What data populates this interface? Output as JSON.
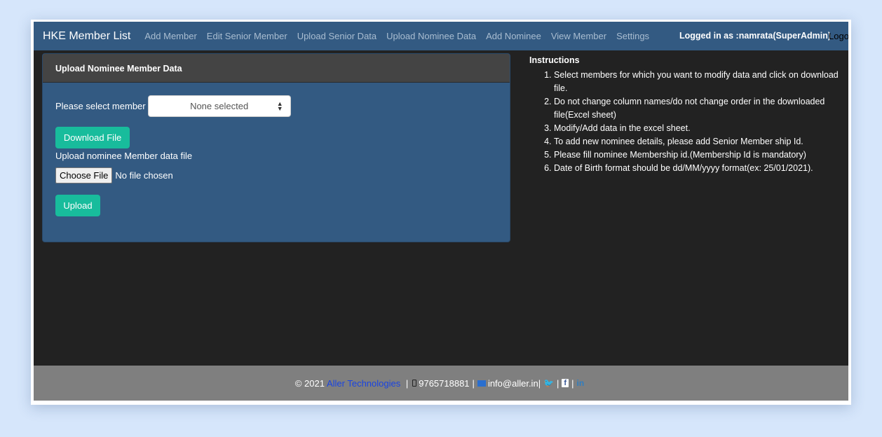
{
  "nav": {
    "brand": "HKE Member List",
    "links": [
      "Add Member",
      "Edit Senior Member",
      "Upload Senior Data",
      "Upload Nominee Data",
      "Add Nominee",
      "View Member",
      "Settings"
    ],
    "logged_in": "Logged in as :namrata(SuperAdmin)",
    "logout": "Logo"
  },
  "panel": {
    "title": "Upload Nominee Member Data",
    "select_label": "Please select member",
    "select_value": "None selected",
    "download_label": "Download File",
    "upload_file_label": "Upload nominee Member data file",
    "choose_file_label": "Choose File",
    "no_file_text": "No file chosen",
    "upload_label": "Upload"
  },
  "instructions": {
    "title": "Instructions",
    "items": [
      "Select members for which you want to modify data and click on download file.",
      "Do not change column names/do not change order in the downloaded file(Excel sheet)",
      "Modify/Add data in the excel sheet.",
      "To add new nominee details, please add Senior Member ship Id.",
      "Please fill nominee Membership id.(Membership Id is mandatory)",
      "Date of Birth format should be dd/MM/yyyy format(ex: 25/01/2021)."
    ]
  },
  "footer": {
    "copyright": "© 2021",
    "company": "Aller Technologies",
    "phone": "9765718881",
    "email": "info@aller.in",
    "twitter": "🐦",
    "facebook": "f",
    "linkedin": "in"
  },
  "colors": {
    "navbar": "#335a82",
    "panel": "#335a82",
    "accent_green": "#18bc9c",
    "background": "#222222",
    "footer": "#7f7f7f"
  }
}
